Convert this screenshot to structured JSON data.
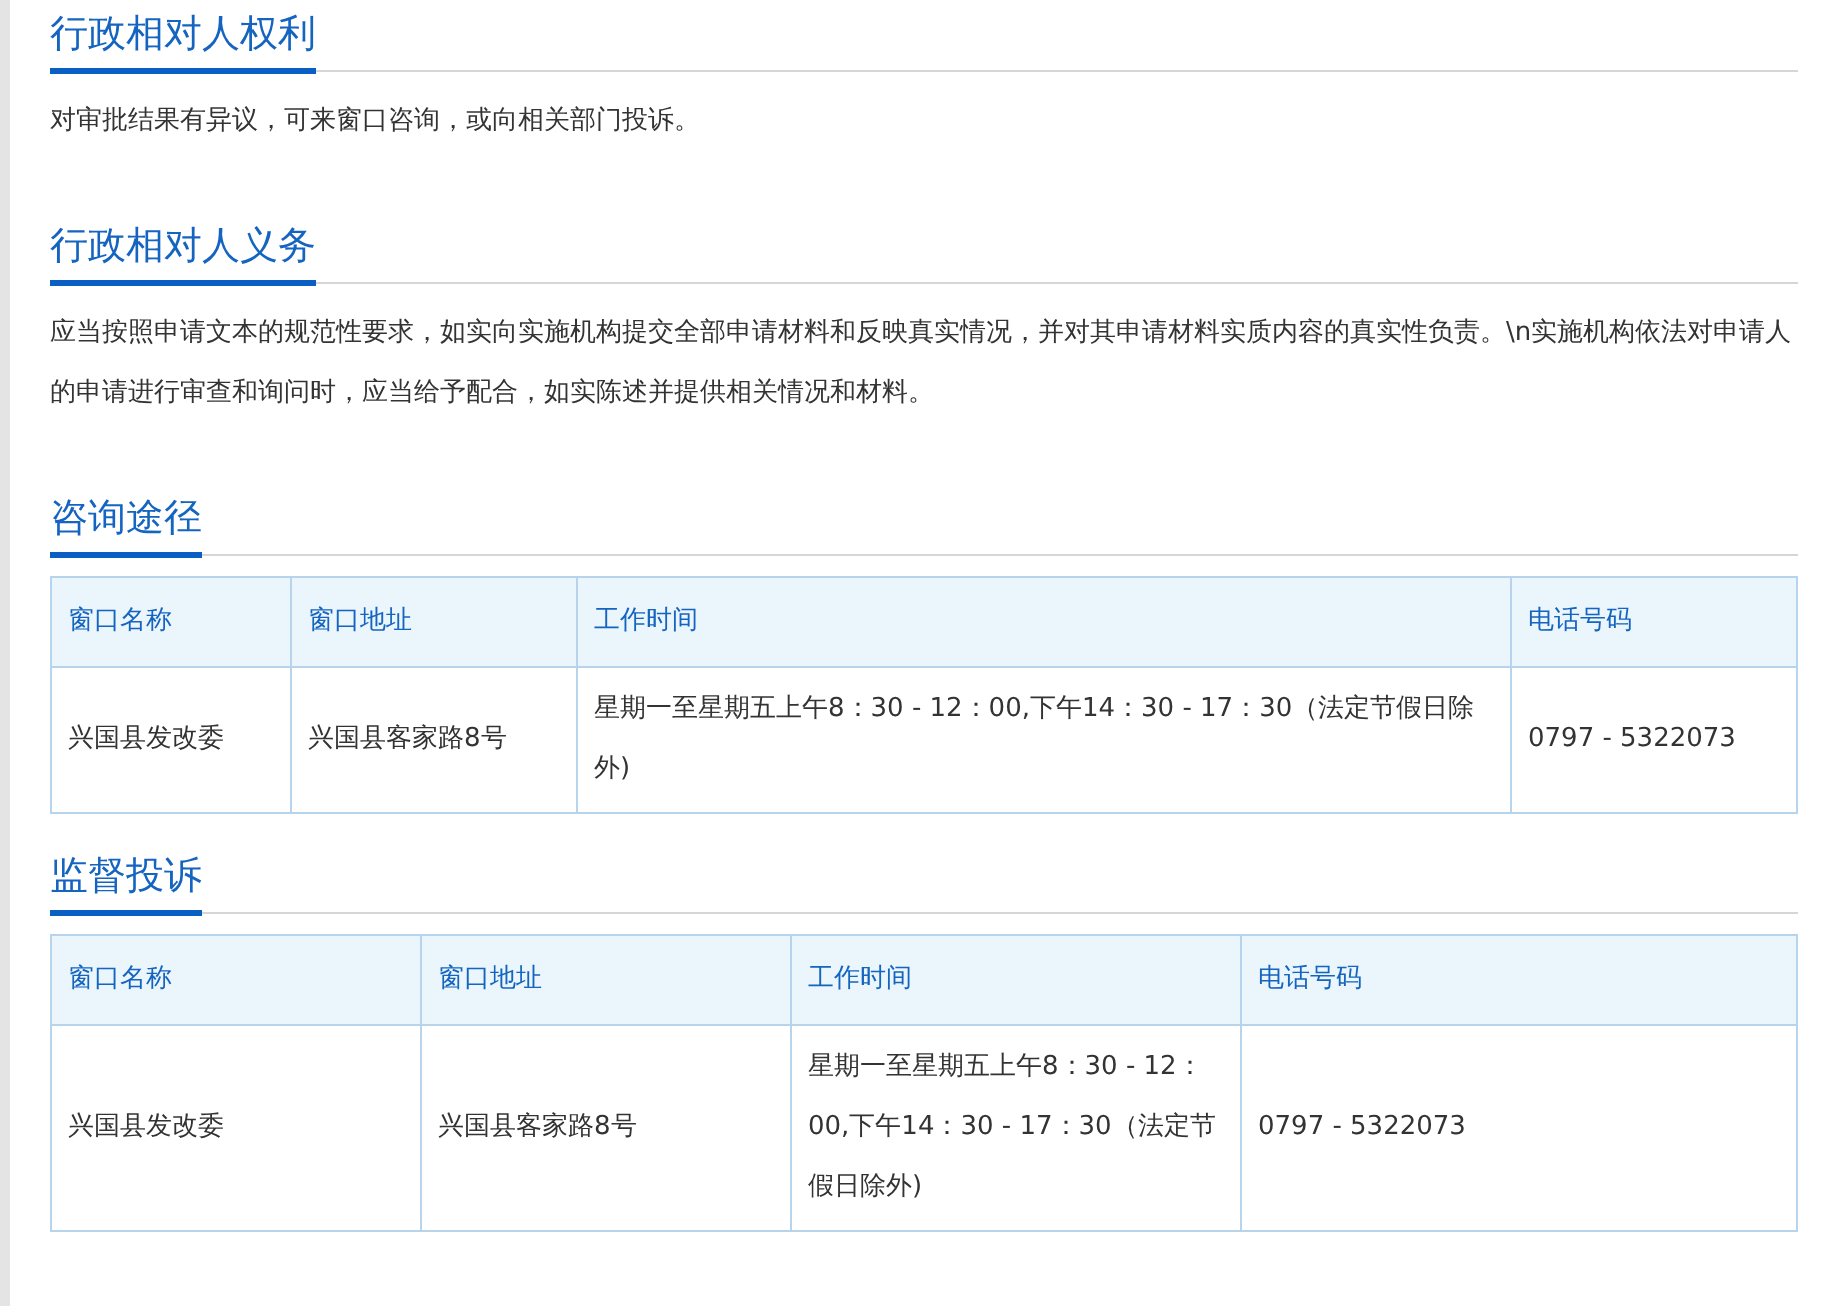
{
  "sections": [
    {
      "kind": "text",
      "title": "行政相对人权利",
      "text": "对审批结果有异议，可来窗口咨询，或向相关部门投诉。"
    },
    {
      "kind": "text",
      "title": "行政相对人义务",
      "text": "应当按照申请文本的规范性要求，如实向实施机构提交全部申请材料和反映真实情况，并对其申请材料实质内容的真实性负责。\\n实施机构依法对申请人的申请进行审查和询问时，应当给予配合，如实陈述并提供相关情况和材料。"
    },
    {
      "kind": "table",
      "title": "咨询途径",
      "columns": [
        "窗口名称",
        "窗口地址",
        "工作时间",
        "电话号码"
      ],
      "rows": [
        [
          "兴国县发改委",
          "兴国县客家路8号",
          "星期一至星期五上午8：30 - 12：00,下午14：30 - 17：30（法定节假日除外)",
          "0797 - 5322073"
        ]
      ]
    },
    {
      "kind": "table",
      "title": "监督投诉",
      "columns": [
        "窗口名称",
        "窗口地址",
        "工作时间",
        "电话号码"
      ],
      "rows": [
        [
          "兴国县发改委",
          "兴国县客家路8号",
          "星期一至星期五上午8：30 - 12：00,下午14：30 - 17：30（法定节假日除外)",
          "0797 - 5322073"
        ]
      ]
    }
  ]
}
